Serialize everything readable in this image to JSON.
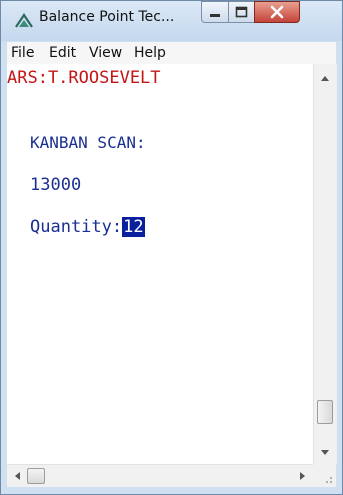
{
  "window": {
    "title": "Balance Point Tec...",
    "menu": [
      "File",
      "Edit",
      "View",
      "Help"
    ]
  },
  "terminal": {
    "header": "ARS:T.ROOSEVELT",
    "prompt_label": "KANBAN SCAN:",
    "scan_value": "13000",
    "quantity_label": "Quantity:",
    "quantity_value": "12"
  },
  "colors": {
    "header_text": "#c41616",
    "body_text": "#1a2f92",
    "selection_bg": "#0a1f9e"
  }
}
